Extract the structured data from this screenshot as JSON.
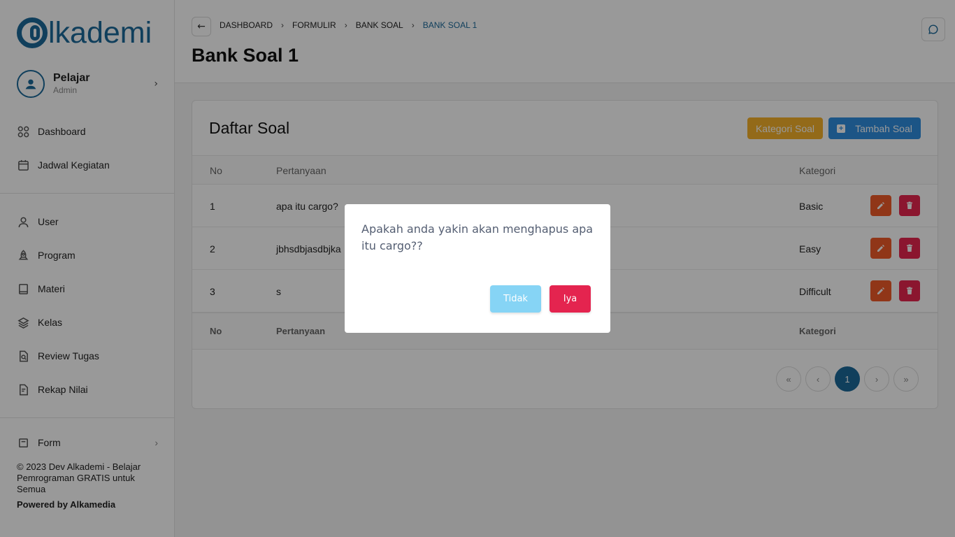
{
  "app": {
    "logo_text": "lkademi"
  },
  "profile": {
    "name": "Pelajar",
    "role": "Admin"
  },
  "sidebar": {
    "items": [
      {
        "label": "Dashboard",
        "icon": "grid-icon"
      },
      {
        "label": "Jadwal Kegiatan",
        "icon": "calendar-icon"
      },
      {
        "label": "User",
        "icon": "user-icon"
      },
      {
        "label": "Program",
        "icon": "rocket-icon"
      },
      {
        "label": "Materi",
        "icon": "book-icon"
      },
      {
        "label": "Kelas",
        "icon": "layers-icon"
      },
      {
        "label": "Review Tugas",
        "icon": "file-search-icon"
      },
      {
        "label": "Rekap Nilai",
        "icon": "file-edit-icon"
      },
      {
        "label": "Form",
        "icon": "form-icon"
      }
    ]
  },
  "footer": {
    "copyright": "© 2023 Dev Alkademi - Belajar Pemrograman GRATIS untuk Semua",
    "powered": "Powered by Alkamedia"
  },
  "header": {
    "breadcrumbs": [
      "DASHBOARD",
      "FORMULIR",
      "BANK SOAL",
      "BANK SOAL 1"
    ],
    "title": "Bank Soal 1"
  },
  "card": {
    "title": "Daftar Soal",
    "kategori_button": "Kategori Soal",
    "tambah_button": "Tambah Soal"
  },
  "table": {
    "columns": [
      "No",
      "Pertanyaan",
      "Kategori"
    ],
    "rows": [
      {
        "no": "1",
        "pertanyaan": "apa itu cargo?",
        "kategori": "Basic"
      },
      {
        "no": "2",
        "pertanyaan": "jbhsdbjasdbjka",
        "kategori": "Easy"
      },
      {
        "no": "3",
        "pertanyaan": "s",
        "kategori": "Difficult"
      }
    ]
  },
  "pagination": {
    "first": "«",
    "prev": "‹",
    "current": "1",
    "next": "›",
    "last": "»"
  },
  "modal": {
    "message": "Apakah anda yakin akan menghapus apa itu cargo??",
    "cancel_label": "Tidak",
    "confirm_label": "Iya"
  }
}
